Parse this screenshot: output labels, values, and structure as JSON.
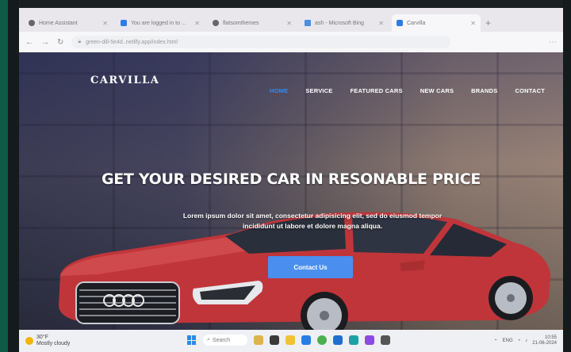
{
  "browser": {
    "tabs": [
      {
        "label": "Home Assistant",
        "active": false
      },
      {
        "label": "You are logged in to ...",
        "active": false
      },
      {
        "label": "flatsomthemes",
        "active": false
      },
      {
        "label": "ash - Microsoft Bing",
        "active": false
      },
      {
        "label": "Carvilla",
        "active": true
      }
    ],
    "address": "green-dill-5e4d..netlify.app/index.html"
  },
  "site": {
    "logo": "CARVILLA",
    "nav": [
      {
        "label": "HOME",
        "active": true
      },
      {
        "label": "SERVICE",
        "active": false
      },
      {
        "label": "FEATURED CARS",
        "active": false
      },
      {
        "label": "NEW CARS",
        "active": false
      },
      {
        "label": "BRANDS",
        "active": false
      },
      {
        "label": "CONTACT",
        "active": false
      }
    ],
    "headline": "GET YOUR DESIRED CAR IN RESONABLE PRICE",
    "subtext": "Lorem ipsum dolor sit amet, consectetur adipisicing elit, sed do eiusmod tempor incididunt ut labore et dolore magna aliqua.",
    "cta_label": "Contact Us",
    "accent": "#2f8cff",
    "button_color": "#4a8ff0"
  },
  "taskbar": {
    "weather_temp": "30°F",
    "weather_desc": "Mostly cloudy",
    "search_placeholder": "Search",
    "lang": "ENG",
    "time": "10:55",
    "date": "21-06-2024"
  }
}
